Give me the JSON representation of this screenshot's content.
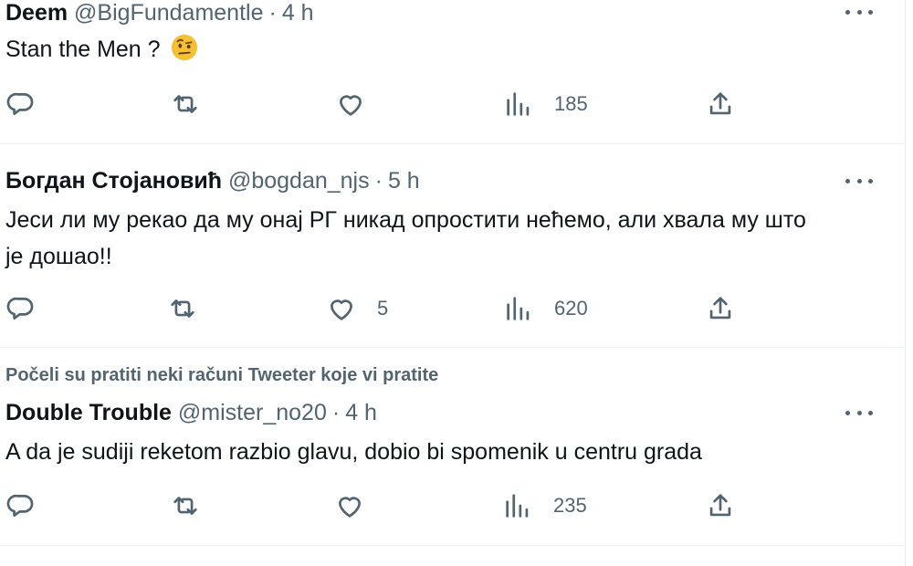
{
  "tweets": [
    {
      "name": "Deem",
      "handle": "@BigFundamentle",
      "dot": "·",
      "time": "4 h",
      "text": "Stan the Men ?",
      "emoji": "face-with-raised-eyebrow-emoji",
      "reply_count": "",
      "retweet_count": "",
      "like_count": "",
      "views": "185"
    },
    {
      "name": "Богдан Стојановић",
      "handle": "@bogdan_njs",
      "dot": "·",
      "time": "5 h",
      "text_line1": "Јеси ли му рекао да му онај РГ никад опростити нећемо, али хвала му што",
      "text_line2": "је дошао!!",
      "reply_count": "",
      "retweet_count": "",
      "like_count": "5",
      "views": "620"
    },
    {
      "social_context": "Počeli su pratiti neki računi Tweeter koje vi pratite",
      "name": "Double Trouble",
      "handle": "@mister_no20",
      "dot": "·",
      "time": "4 h",
      "text": "A da je sudiji reketom razbio glavu, dobio bi spomenik u centru grada",
      "reply_count": "",
      "retweet_count": "",
      "like_count": "",
      "views": "235"
    }
  ],
  "icons": {
    "reply": "reply-icon",
    "retweet": "retweet-icon",
    "like": "like-heart-icon",
    "views": "views-bar-chart-icon",
    "share": "share-upload-icon",
    "more": "more-dots-icon"
  },
  "colors": {
    "text": "#0f1419",
    "secondary": "#536471",
    "divider": "#eff3f4"
  }
}
